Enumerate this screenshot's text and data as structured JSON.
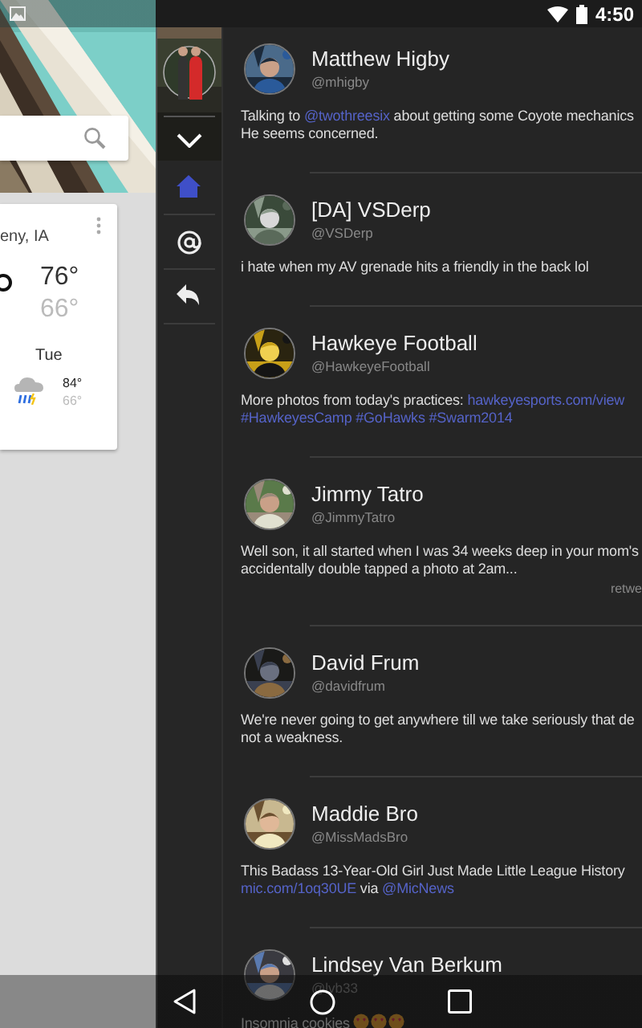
{
  "status_bar": {
    "time": "4:50"
  },
  "launcher": {
    "weather": {
      "location": "eny, IA",
      "high": "76°",
      "low": "66°",
      "forecast": [
        {
          "day": "Tue",
          "high": "84°",
          "low": "66°"
        }
      ]
    }
  },
  "nav_rail": {
    "items": [
      {
        "kind": "home",
        "selected": true
      },
      {
        "kind": "mentions",
        "selected": false
      },
      {
        "kind": "reply",
        "selected": false
      }
    ]
  },
  "tweets": [
    {
      "name": "Matthew Higby",
      "handle": "@mhigby",
      "lines": [
        [
          {
            "kind": "plain",
            "text": "Talking to "
          },
          {
            "kind": "link",
            "text": "@twothreesix"
          },
          {
            "kind": "plain",
            "text": " about getting some Coyote mechanics"
          }
        ],
        [
          {
            "kind": "plain",
            "text": "He seems concerned."
          }
        ]
      ]
    },
    {
      "name": "[DA] VSDerp",
      "handle": "@VSDerp",
      "lines": [
        [
          {
            "kind": "plain",
            "text": "i hate when my AV grenade hits a friendly in the back lol"
          }
        ]
      ]
    },
    {
      "name": "Hawkeye Football",
      "handle": "@HawkeyeFootball",
      "lines": [
        [
          {
            "kind": "plain",
            "text": "More photos from today's practices: "
          },
          {
            "kind": "link",
            "text": "hawkeyesports.com/view"
          }
        ],
        [
          {
            "kind": "link",
            "text": "#HawkeyesCamp #GoHawks #Swarm2014"
          }
        ]
      ]
    },
    {
      "name": "Jimmy Tatro",
      "handle": "@JimmyTatro",
      "lines": [
        [
          {
            "kind": "plain",
            "text": "Well son, it all started when I was 34 weeks deep in your mom's"
          }
        ],
        [
          {
            "kind": "plain",
            "text": "accidentally double tapped a photo at 2am..."
          }
        ]
      ],
      "retweet": "retwe"
    },
    {
      "name": "David Frum",
      "handle": "@davidfrum",
      "lines": [
        [
          {
            "kind": "plain",
            "text": "We're never going to get anywhere till we take seriously that de"
          }
        ],
        [
          {
            "kind": "plain",
            "text": "not a weakness."
          }
        ]
      ]
    },
    {
      "name": "Maddie Bro",
      "handle": "@MissMadsBro",
      "lines": [
        [
          {
            "kind": "plain",
            "text": "This Badass 13-Year-Old Girl Just Made Little League History"
          }
        ],
        [
          {
            "kind": "link",
            "text": "mic.com/1oq30UE"
          },
          {
            "kind": "plain",
            "text": " via "
          },
          {
            "kind": "link",
            "text": "@MicNews"
          }
        ]
      ]
    },
    {
      "name": "Lindsey Van Berkum",
      "handle": "@lvb33",
      "lines": [
        [
          {
            "kind": "plain",
            "text": "Insomnia cookies "
          },
          {
            "kind": "emoji"
          },
          {
            "kind": "emoji"
          },
          {
            "kind": "emoji"
          }
        ]
      ]
    }
  ]
}
